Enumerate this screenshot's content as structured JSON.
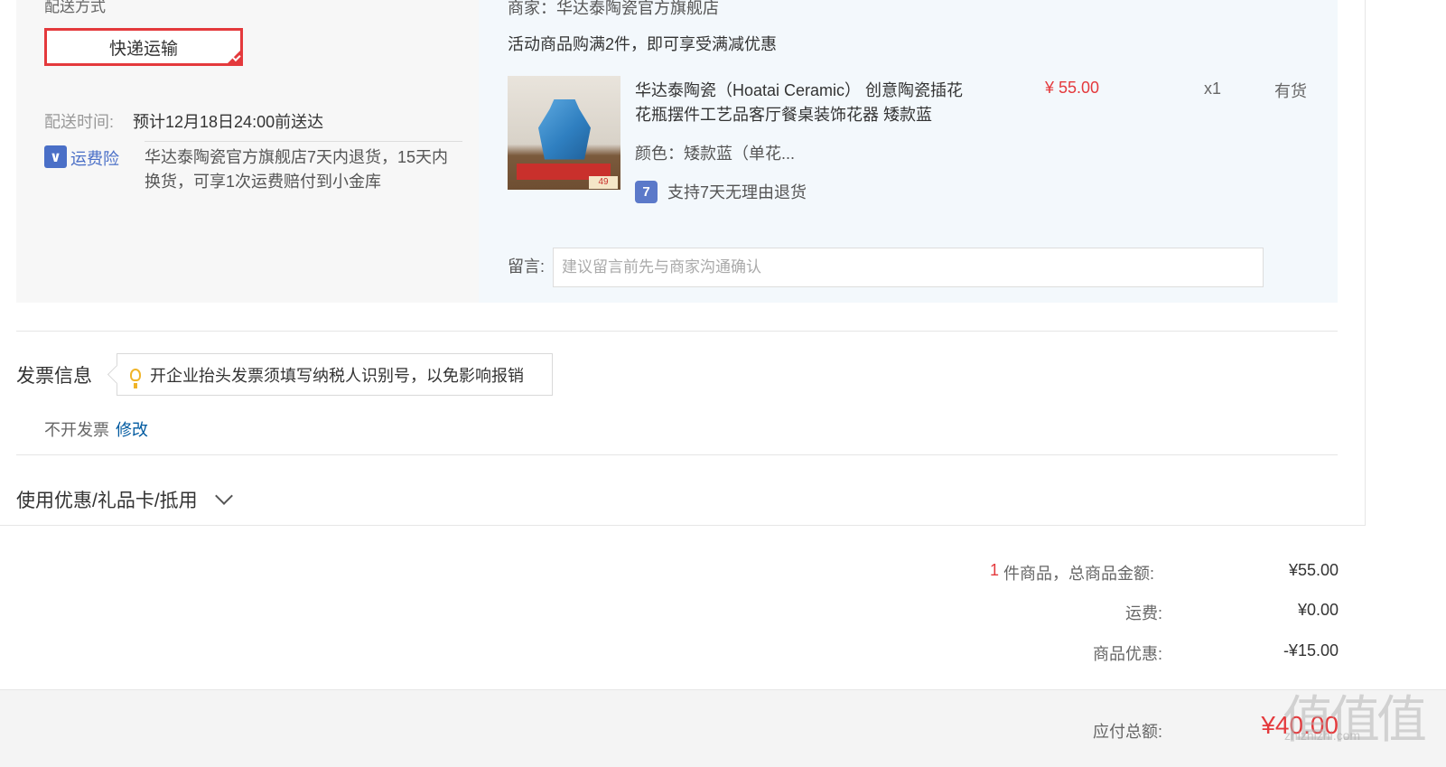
{
  "delivery": {
    "section_label": "配送方式",
    "method_button": "快递运输",
    "time_label": "配送时间:",
    "time_value": "预计12月18日24:00前送达",
    "insurance_label": "运费险",
    "insurance_text_line1": "华达泰陶瓷官方旗舰店7天内退货，15天内",
    "insurance_text_line2": "换货，可享1次运费赔付到小金库"
  },
  "merchant": {
    "name_line": "商家：华达泰陶瓷官方旗舰店",
    "promo": "活动商品购满2件，即可享受满减优惠"
  },
  "product": {
    "title_line1": "华达泰陶瓷（Hoatai Ceramic） 创意陶瓷插花",
    "title_line2": "花瓶摆件工艺品客厅餐桌装饰花器 矮款蓝",
    "price": "¥ 55.00",
    "quantity": "x1",
    "stock": "有货",
    "color": "颜色：矮款蓝（单花...",
    "return_policy": "支持7天无理由退货",
    "return_icon_text": "7",
    "image_badge": "49"
  },
  "remark": {
    "label": "留言:",
    "placeholder": "建议留言前先与商家沟通确认"
  },
  "invoice": {
    "title": "发票信息",
    "tip": "开企业抬头发票须填写纳税人识别号，以免影响报销",
    "status": "不开发票",
    "edit_link": "修改"
  },
  "coupon": {
    "title": "使用优惠/礼品卡/抵用"
  },
  "summary": {
    "item_count": "1",
    "item_label": "件商品，总商品金额:",
    "item_total": "¥55.00",
    "shipping_label": "运费:",
    "shipping_value": "¥0.00",
    "discount_label": "商品优惠:",
    "discount_value": "-¥15.00",
    "total_label": "应付总额:",
    "total_value": "¥40.00"
  },
  "watermark": {
    "logo": "值值值",
    "site": "zhizhizhi.com"
  },
  "colors": {
    "accent_red": "#e4393c",
    "link_blue": "#005aa0",
    "panel_blue": "#f3f8fc"
  }
}
